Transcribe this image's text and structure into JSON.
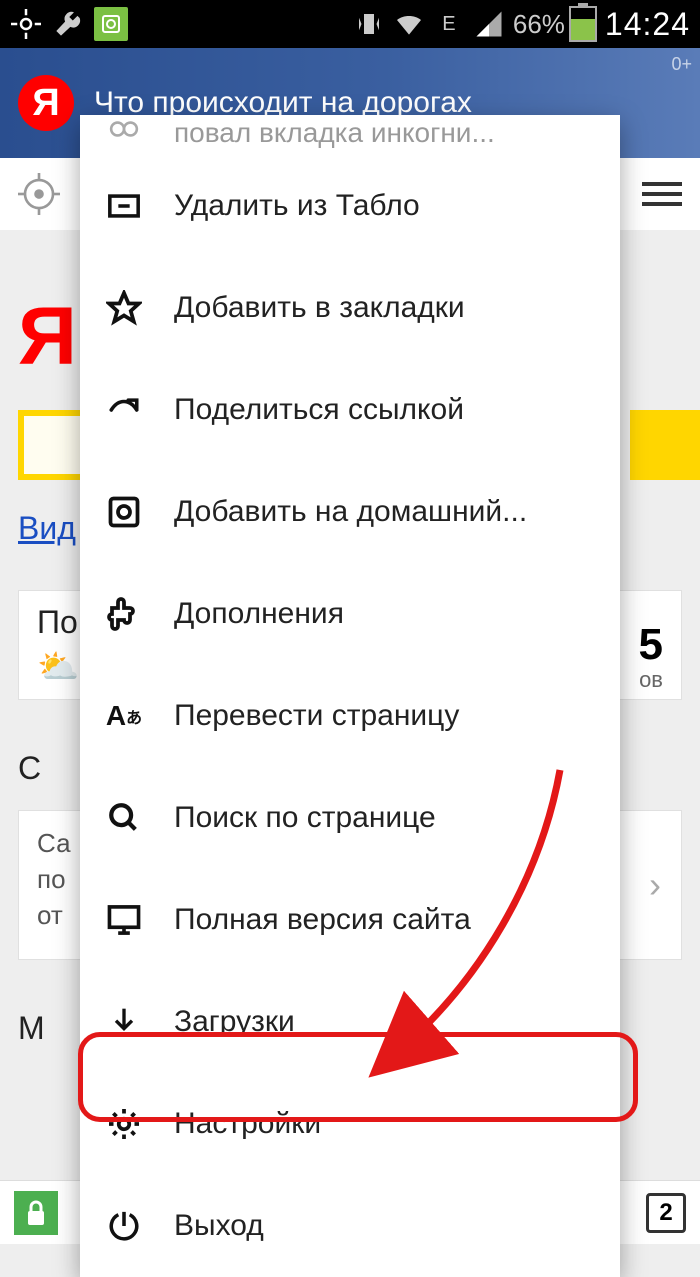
{
  "status_bar": {
    "battery_percent": "66%",
    "time": "14:24",
    "net_indicator": "E"
  },
  "banner": {
    "logo": "Я",
    "text": "Что происходит на дорогах",
    "age": "0+"
  },
  "main": {
    "logo": "Я",
    "video_link": "Вид",
    "weather_prefix": "По",
    "temp": "5",
    "temp_suffix": "ов",
    "section_c": "С",
    "card_line1": "Са",
    "card_line2": "по",
    "card_line3": "от",
    "section_m": "М"
  },
  "menu": {
    "clipped_top": "повал вкладка инкогни...",
    "items": [
      {
        "id": "remove-tablo",
        "label": "Удалить из Табло"
      },
      {
        "id": "add-bookmark",
        "label": "Добавить в закладки"
      },
      {
        "id": "share-link",
        "label": "Поделиться ссылкой"
      },
      {
        "id": "add-home",
        "label": "Добавить на домашний..."
      },
      {
        "id": "extensions",
        "label": "Дополнения"
      },
      {
        "id": "translate",
        "label": "Перевести страницу"
      },
      {
        "id": "find-page",
        "label": "Поиск по странице"
      },
      {
        "id": "desktop-site",
        "label": "Полная версия сайта"
      },
      {
        "id": "downloads",
        "label": "Загрузки"
      },
      {
        "id": "settings",
        "label": "Настройки"
      },
      {
        "id": "exit",
        "label": "Выход"
      }
    ]
  },
  "bottom_bar": {
    "tab_count": "2"
  }
}
